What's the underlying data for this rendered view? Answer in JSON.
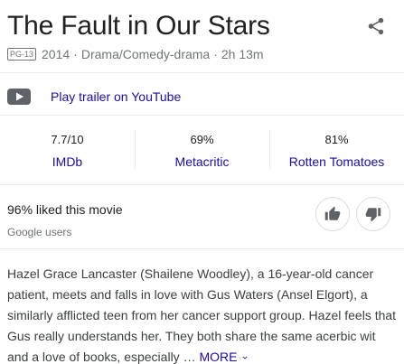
{
  "movie": {
    "title": "The Fault in Our Stars",
    "rating_badge": "PG-13",
    "year": "2014",
    "genre": "Drama/Comedy-drama",
    "runtime": "2h 13m",
    "separator": "·"
  },
  "trailer": {
    "label": "Play trailer on YouTube",
    "icon": "youtube-play-icon"
  },
  "ratings": [
    {
      "value": "7.7/10",
      "source": "IMDb"
    },
    {
      "value": "69%",
      "source": "Metacritic"
    },
    {
      "value": "81%",
      "source": "Rotten Tomatoes"
    }
  ],
  "audience": {
    "liked": "96% liked this movie",
    "source": "Google users"
  },
  "description": {
    "text": "Hazel Grace Lancaster (Shailene Woodley), a 16-year-old cancer patient, meets and falls in love with Gus Waters (Ansel Elgort), a similarly afflicted teen from her cancer support group. Hazel feels that Gus really understands her. They both share the same acerbic wit and a love of books, especially …",
    "more_label": "MORE"
  },
  "colors": {
    "link": "#1a0dab",
    "muted": "#70757a",
    "text": "#202124",
    "divider": "#ebebeb",
    "icon": "#5f6368"
  }
}
